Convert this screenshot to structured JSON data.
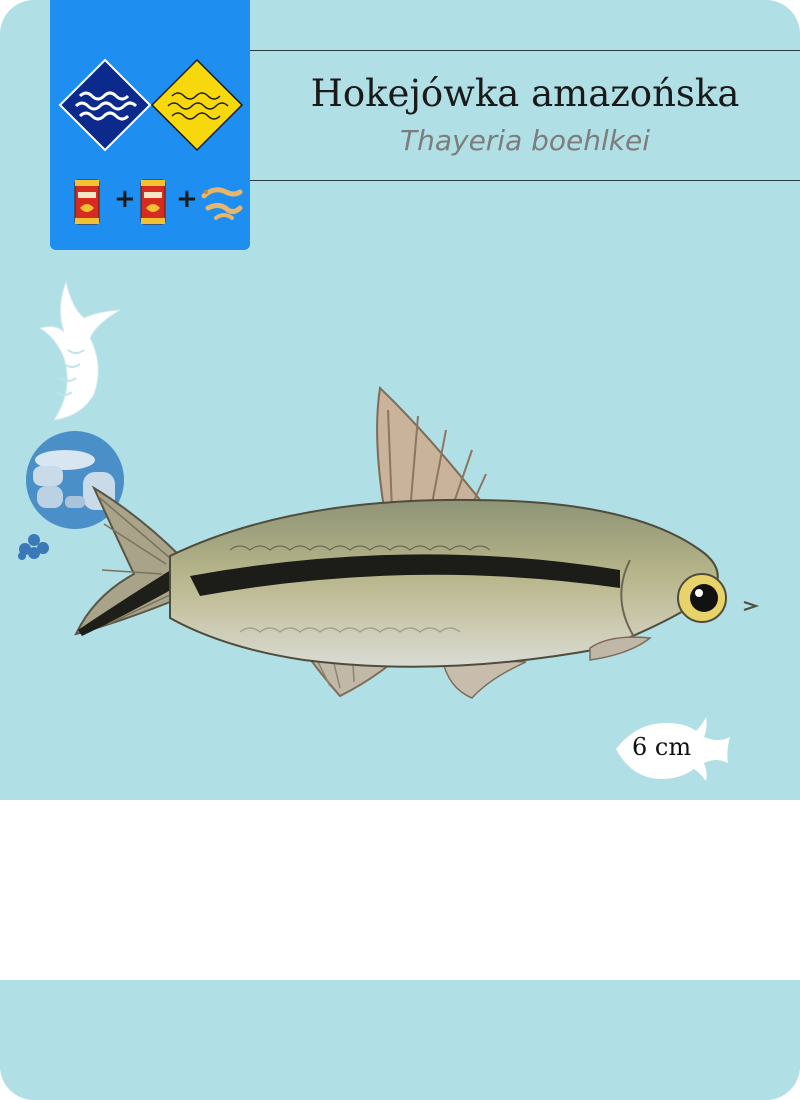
{
  "card": {
    "common_name": "Hokejówka amazońska",
    "latin_name": "Thayeria boehlkei",
    "size": "6 cm"
  },
  "badges": {
    "water_types": [
      "water-waves-dark-icon",
      "water-waves-yellow-icon"
    ],
    "food": [
      "food-can-icon",
      "food-can-icon",
      "shrimp-food-icon"
    ],
    "plus_sign": "+"
  },
  "habitat_icons": [
    "tail-fin-icon",
    "stones-icon",
    "eggs-icon"
  ],
  "colors": {
    "card_bg": "#b0dfe5",
    "badge_panel": "#1e8ff0",
    "water_dark": "#0b2a8c",
    "water_yellow": "#f6d80c"
  }
}
